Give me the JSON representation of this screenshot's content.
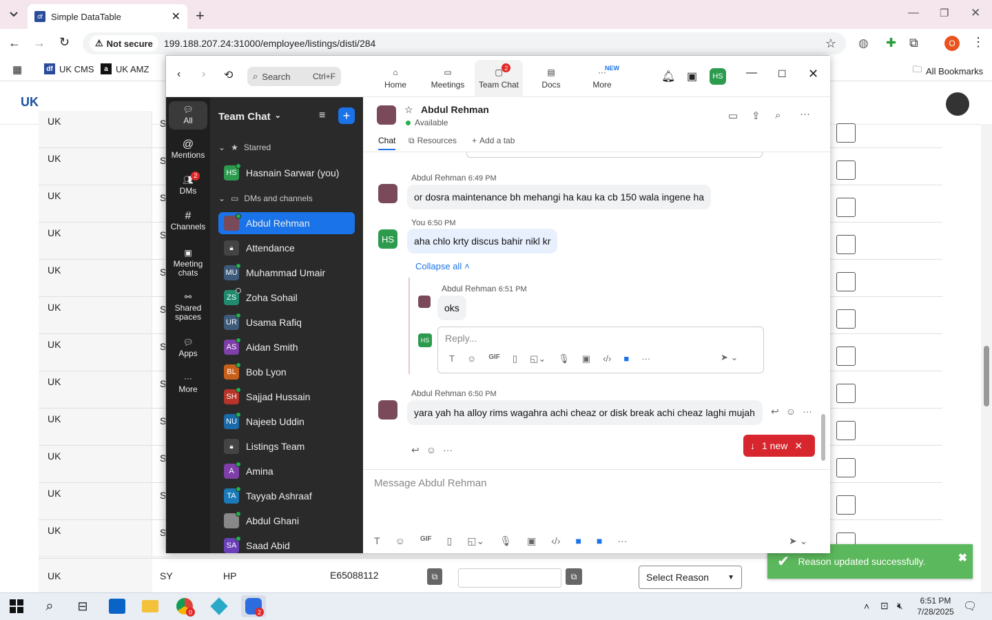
{
  "browser": {
    "tab_title": "Simple DataTable",
    "tab_favicon": "df",
    "not_secure": "Not secure",
    "url": "199.188.207.24:31000/employee/listings/disti/284",
    "bookmarks": [
      {
        "label": "UK CMS"
      },
      {
        "label": "UK AMZ"
      }
    ],
    "all_bookmarks": "All Bookmarks",
    "profile_initial": "O"
  },
  "page": {
    "logo": "UK",
    "rows": [
      {
        "c1": "UK",
        "c2": "S"
      },
      {
        "c1": "UK",
        "c2": "S"
      },
      {
        "c1": "UK",
        "c2": "S"
      },
      {
        "c1": "UK",
        "c2": "S"
      },
      {
        "c1": "UK",
        "c2": "S"
      },
      {
        "c1": "UK",
        "c2": "S"
      },
      {
        "c1": "UK",
        "c2": "S"
      },
      {
        "c1": "UK",
        "c2": "S"
      },
      {
        "c1": "UK",
        "c2": "S"
      },
      {
        "c1": "UK",
        "c2": "S"
      },
      {
        "c1": "UK",
        "c2": "S"
      },
      {
        "c1": "UK",
        "c2": "S"
      }
    ],
    "last_row": {
      "c1": "UK",
      "c2": "SY",
      "c3": "HP",
      "c4": "E65088112",
      "select": "Select Reason"
    },
    "toast": "Reason updated successfully."
  },
  "zoom": {
    "search_label": "Search",
    "search_shortcut": "Ctrl+F",
    "nav": [
      {
        "label": "Home"
      },
      {
        "label": "Meetings"
      },
      {
        "label": "Team Chat",
        "badge": "2"
      },
      {
        "label": "Docs"
      },
      {
        "label": "More",
        "badge": "NEW"
      }
    ],
    "avatar": "HS",
    "rail": [
      {
        "label": "All"
      },
      {
        "label": "Mentions"
      },
      {
        "label": "DMs",
        "badge": "2"
      },
      {
        "label": "Channels"
      },
      {
        "label": "Meeting chats"
      },
      {
        "label": "Shared spaces"
      },
      {
        "label": "Apps"
      },
      {
        "label": "More"
      }
    ],
    "list_title": "Team Chat",
    "starred_label": "Starred",
    "starred": [
      {
        "initials": "HS",
        "name": "Hasnain Sarwar (you)",
        "color": "#2d9b4e"
      }
    ],
    "dms_label": "DMs and channels",
    "contacts": [
      {
        "initials": "",
        "name": "Abdul Rehman",
        "color": "#7a4a5a",
        "selected": true
      },
      {
        "initials": "",
        "name": "Attendance",
        "color": "#555555",
        "lock": true
      },
      {
        "initials": "MU",
        "name": "Muhammad Umair",
        "color": "#3d5a7a"
      },
      {
        "initials": "ZS",
        "name": "Zoha Sohail",
        "color": "#1f8a6e",
        "offline": true
      },
      {
        "initials": "UR",
        "name": "Usama Rafiq",
        "color": "#3d5a7a"
      },
      {
        "initials": "AS",
        "name": "Aidan Smith",
        "color": "#7e3fa8"
      },
      {
        "initials": "BL",
        "name": "Bob Lyon",
        "color": "#c8601a"
      },
      {
        "initials": "SH",
        "name": "Sajjad Hussain",
        "color": "#b8342a"
      },
      {
        "initials": "NU",
        "name": "Najeeb Uddin",
        "color": "#1a6aa8"
      },
      {
        "initials": "",
        "name": "Listings Team",
        "color": "#555555",
        "lock": true
      },
      {
        "initials": "A",
        "name": "Amina",
        "color": "#7e3fa8"
      },
      {
        "initials": "TA",
        "name": "Tayyab Ashraaf",
        "color": "#1a7ab8"
      },
      {
        "initials": "",
        "name": "Abdul Ghani",
        "color": "#888888"
      },
      {
        "initials": "SA",
        "name": "Saad Abid",
        "color": "#6a3fb8"
      }
    ],
    "chat": {
      "name": "Abdul Rehman",
      "status": "Available",
      "tabs": [
        {
          "label": "Chat"
        },
        {
          "label": "Resources"
        },
        {
          "label": "Add a tab"
        }
      ],
      "messages": [
        {
          "sender": "Abdul Rehman",
          "time": "6:49 PM",
          "text": "or dosra maintenance bh mehangi ha kau ka cb 150 wala ingene ha"
        },
        {
          "sender": "You",
          "time": "6:50 PM",
          "text": "aha chlo krty discus bahir nikl kr"
        }
      ],
      "collapse": "Collapse all",
      "reply": {
        "sender": "Abdul Rehman",
        "time": "6:51 PM",
        "text": "oks"
      },
      "reply_placeholder": "Reply...",
      "last": {
        "sender": "Abdul Rehman",
        "time": "6:50 PM",
        "text": "yara yah ha alloy rims wagahra achi cheaz or disk break achi cheaz laghi mujah"
      },
      "new_pill": "1 new",
      "compose_placeholder": "Message Abdul Rehman"
    }
  },
  "taskbar": {
    "time": "6:51 PM",
    "date": "7/28/2025",
    "chrome_badge": "0",
    "zoom_badge": "2"
  },
  "colors": {
    "accent": "#1a73e8",
    "alert": "#e02828",
    "toast": "#5cb85c"
  }
}
